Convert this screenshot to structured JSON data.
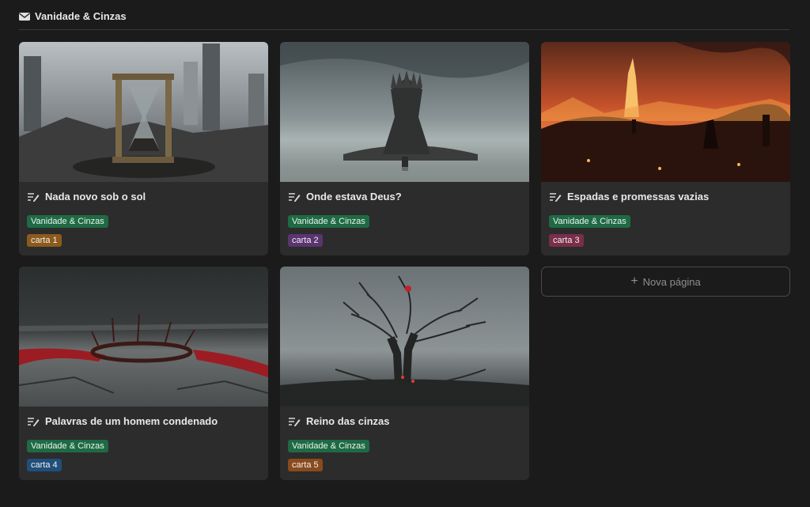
{
  "header": {
    "title": "Vanidade & Cinzas",
    "icon": "mail-icon"
  },
  "cards": [
    {
      "title": "Nada novo sob o sol",
      "tag": "Vanidade & Cinzas",
      "carta": "carta 1",
      "carta_color": "#8c5a1c",
      "cover": "hourglass-ruins"
    },
    {
      "title": "Onde estava Deus?",
      "tag": "Vanidade & Cinzas",
      "carta": "carta 2",
      "carta_color": "#5b3470",
      "cover": "throne-ruins"
    },
    {
      "title": "Espadas e promessas vazias",
      "tag": "Vanidade & Cinzas",
      "carta": "carta 3",
      "carta_color": "#7a2e4a",
      "cover": "burning-field"
    },
    {
      "title": "Palavras de um homem condenado",
      "tag": "Vanidade & Cinzas",
      "carta": "carta 4",
      "carta_color": "#1f4f7a",
      "cover": "crown-of-thorns"
    },
    {
      "title": "Reino das cinzas",
      "tag": "Vanidade & Cinzas",
      "carta": "carta 5",
      "carta_color": "#8a4a1c",
      "cover": "dead-tree"
    }
  ],
  "new_page": {
    "label": "Nova página",
    "icon": "plus-icon"
  }
}
